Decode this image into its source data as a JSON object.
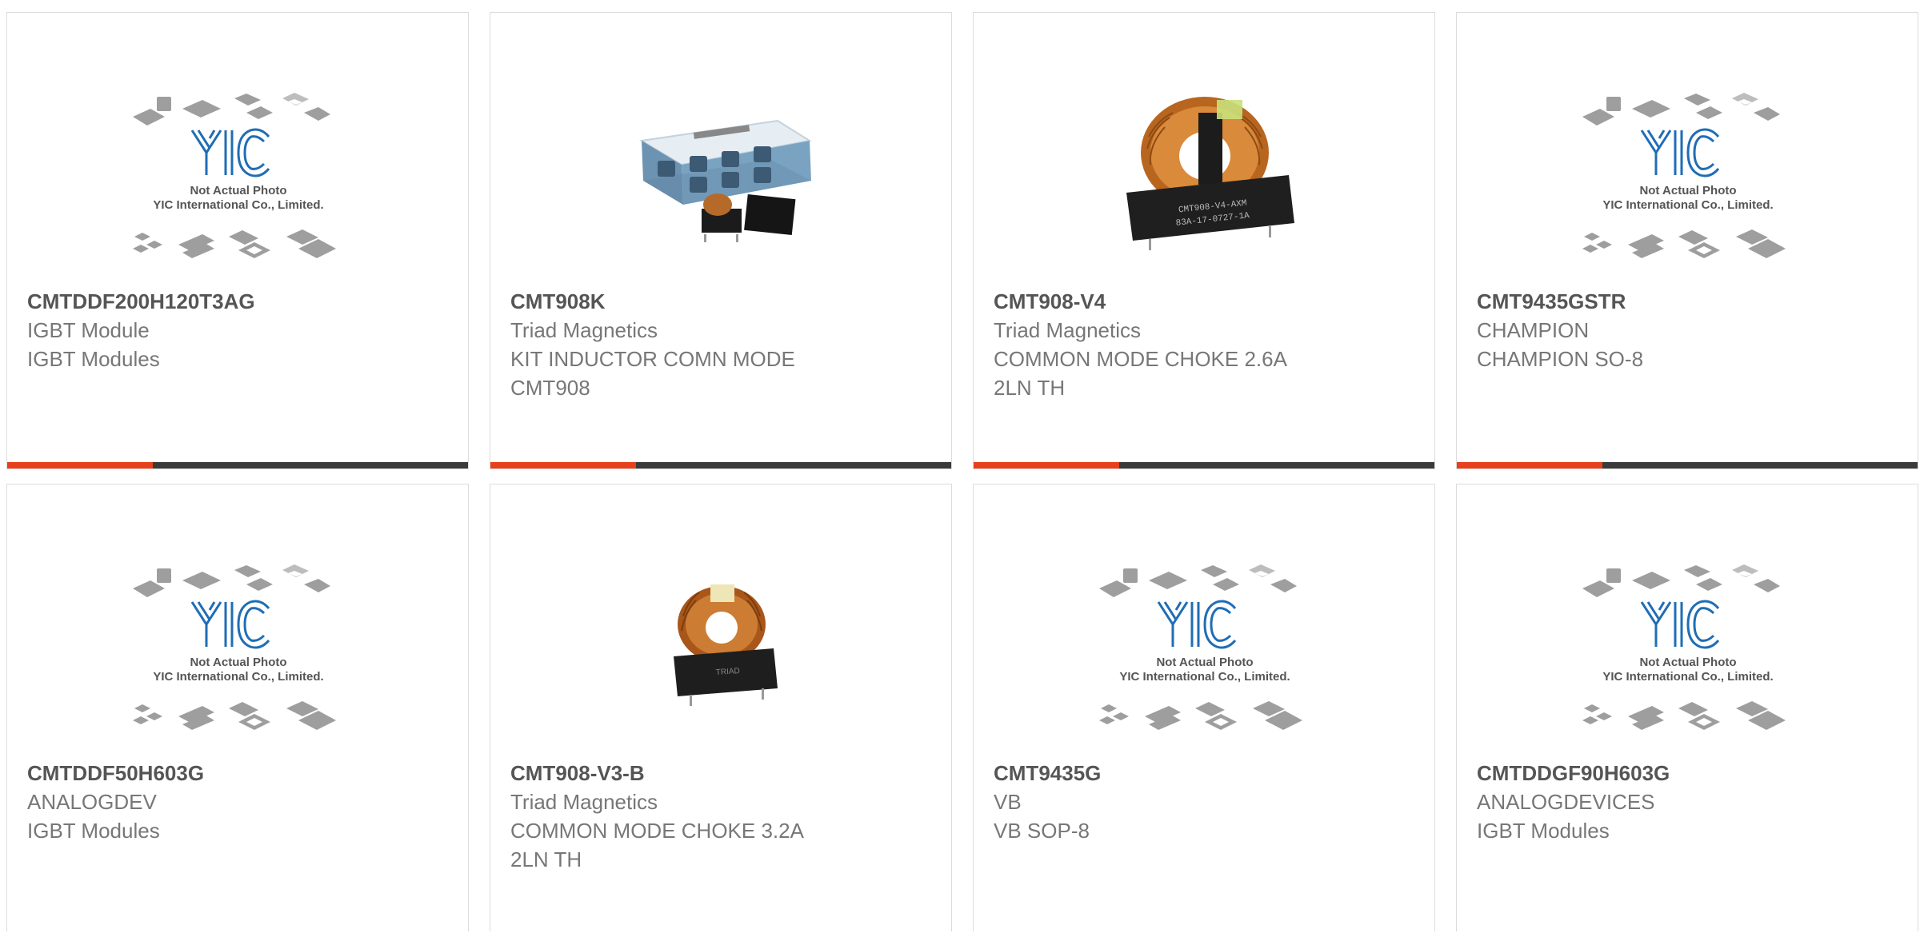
{
  "products": [
    {
      "part": "CMTDDF200H120T3AG",
      "manufacturer": "IGBT Module",
      "description": "IGBT Modules",
      "image": "placeholder"
    },
    {
      "part": "CMT908K",
      "manufacturer": "Triad Magnetics",
      "description": "KIT INDUCTOR COMN MODE CMT908",
      "image": "kit"
    },
    {
      "part": "CMT908-V4",
      "manufacturer": "Triad Magnetics",
      "description": "COMMON MODE CHOKE 2.6A 2LN TH",
      "image": "choke"
    },
    {
      "part": "CMT9435GSTR",
      "manufacturer": "CHAMPION",
      "description": "CHAMPION SO-8",
      "image": "placeholder"
    },
    {
      "part": "CMTDDF50H603G",
      "manufacturer": "ANALOGDEV",
      "description": "IGBT Modules",
      "image": "placeholder"
    },
    {
      "part": "CMT908-V3-B",
      "manufacturer": "Triad Magnetics",
      "description": "COMMON MODE CHOKE 3.2A 2LN TH",
      "image": "choke-small"
    },
    {
      "part": "CMT9435G",
      "manufacturer": "VB",
      "description": "VB SOP-8",
      "image": "placeholder"
    },
    {
      "part": "CMTDDGF90H603G",
      "manufacturer": "ANALOGDEVICES",
      "description": "IGBT Modules",
      "image": "placeholder"
    }
  ],
  "placeholder": {
    "logo": "YIC",
    "line1": "Not Actual Photo",
    "line2": "YIC International Co., Limited."
  },
  "labels": {
    "kit_box": "",
    "choke_marking_1": "CMT908-V4-AXM",
    "choke_marking_2": "83A-17-0727-1A",
    "choke_small_marking": "TRIAD"
  },
  "colors": {
    "accent": "#e8401c",
    "bar": "#3a3a3a",
    "border": "#dcdcdc",
    "logo_blue": "#1f6db5"
  }
}
